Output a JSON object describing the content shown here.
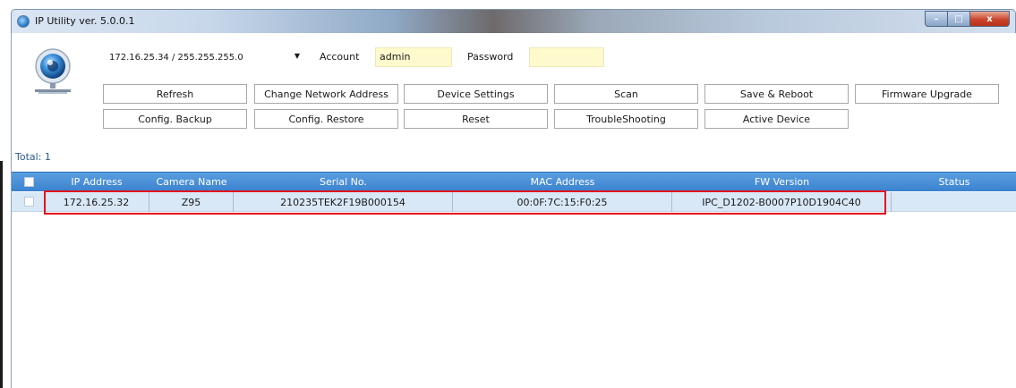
{
  "window": {
    "title": "IP Utility ver. 5.0.0.1",
    "controls": {
      "minimize": "–",
      "maximize": "□",
      "close": "x"
    }
  },
  "toolbar": {
    "network_select": "172.16.25.34 / 255.255.255.0",
    "dropdown_arrow": "▼",
    "account_label": "Account",
    "account_value": "admin",
    "password_label": "Password",
    "password_value": "",
    "buttons_row1": [
      "Refresh",
      "Change Network Address",
      "Device Settings",
      "Scan",
      "Save & Reboot",
      "Firmware Upgrade"
    ],
    "buttons_row2": [
      "Config. Backup",
      "Config. Restore",
      "Reset",
      "TroubleShooting",
      "Active Device"
    ]
  },
  "total_label": "Total: 1",
  "table": {
    "columns": [
      "IP Address",
      "Camera Name",
      "Serial No.",
      "MAC Address",
      "FW Version",
      "Status"
    ],
    "rows": [
      {
        "ip": "172.16.25.32",
        "name": "Z95",
        "serial": "210235TEK2F19B000154",
        "mac": "00:0F:7C:15:F0:25",
        "fw": "IPC_D1202-B0007P10D1904C40",
        "status": ""
      }
    ]
  },
  "colors": {
    "header_blue": "#3b82cf",
    "row_selected": "#d9e8f7",
    "highlight_red": "#e0141c",
    "field_yellow": "#fffacd"
  }
}
